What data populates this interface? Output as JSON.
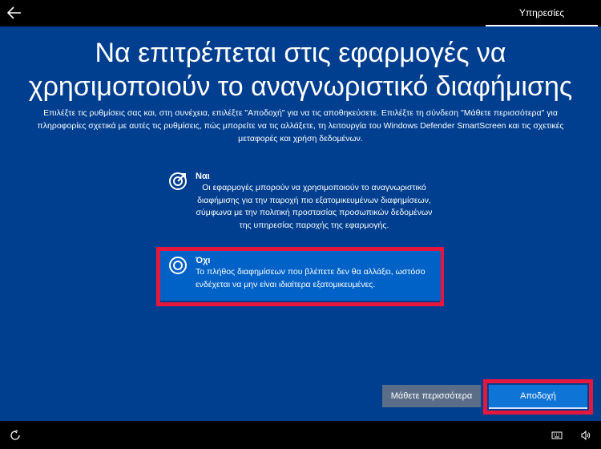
{
  "header": {
    "back_label": "",
    "tab_label": "Υπηρεσίες"
  },
  "main": {
    "title_line1": "Να επιτρέπεται στις εφαρμογές να",
    "title_line2": "χρησιμοποιούν το αναγνωριστικό διαφήμισης",
    "description": "Επιλέξτε τις ρυθμίσεις σας και, στη συνέχεια, επιλέξτε \"Αποδοχή\" για να τις αποθηκεύσετε. Επιλέξτε τη σύνδεση \"Μάθετε περισσότερα\" για πληροφορίες σχετικά με αυτές τις ρυθμίσεις, πώς μπορείτε να τις αλλάξετε, τη λειτουργία του Windows Defender SmartScreen και τις σχετικές μεταφορές και χρήση δεδομένων.",
    "options": [
      {
        "title": "Ναι",
        "text": "Οι εφαρμογές μπορούν να χρησιμοποιούν το αναγνωριστικό διαφήμισης για την παροχή πιο εξατομικευμένων διαφημίσεων, σύμφωνα με την πολιτική προστασίας προσωπικών δεδομένων της υπηρεσίας παροχής της εφαρμογής.",
        "icon": "target-icon",
        "selected": false
      },
      {
        "title": "Όχι",
        "text": "Το πλήθος διαφημίσεων που βλέπετε δεν θα αλλάξει, ωστόσο ενδέχεται να μην είναι ιδιαίτερα εξατομικευμένες.",
        "icon": "target-icon",
        "selected": true
      }
    ]
  },
  "buttons": {
    "learn_more": "Μάθετε περισσότερα",
    "accept": "Αποδοχή"
  },
  "colors": {
    "background": "#003e8f",
    "selected_option": "#0061c7",
    "accept_button": "#0e74d6",
    "learn_button": "#5a6e87",
    "highlight": "#e5173d"
  },
  "bottom_bar": {
    "icons": [
      "ease-of-access-icon",
      "keyboard-icon",
      "volume-icon"
    ]
  }
}
